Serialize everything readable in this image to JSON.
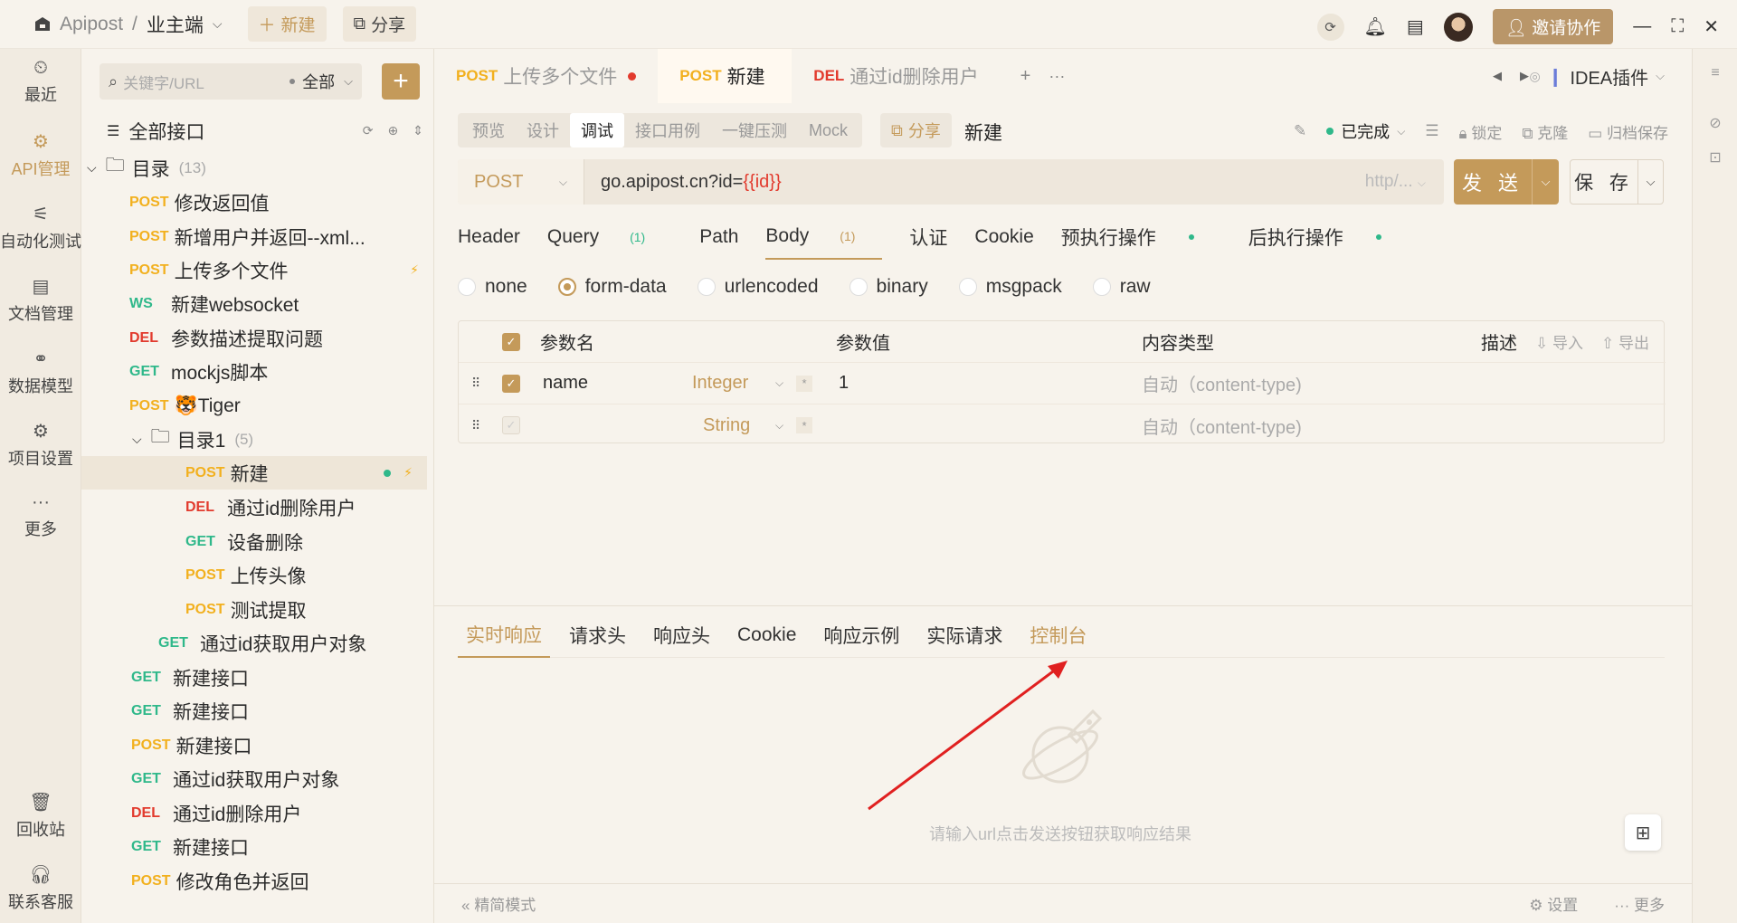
{
  "titlebar": {
    "app_name": "Apipost",
    "separator": "/",
    "project": "业主端",
    "new_label": "新建",
    "share_label": "分享",
    "invite_label": "邀请协作"
  },
  "rail": {
    "items": [
      {
        "label": "最近",
        "icon": "clock-icon"
      },
      {
        "label": "API管理",
        "icon": "api-icon"
      },
      {
        "label": "自动化测试",
        "icon": "automation-icon"
      },
      {
        "label": "文档管理",
        "icon": "document-icon"
      },
      {
        "label": "数据模型",
        "icon": "model-icon"
      },
      {
        "label": "项目设置",
        "icon": "settings-icon"
      },
      {
        "label": "更多",
        "icon": "more-icon"
      }
    ],
    "bottom": [
      {
        "label": "回收站",
        "icon": "trash-icon"
      },
      {
        "label": "联系客服",
        "icon": "headset-icon"
      }
    ]
  },
  "tree": {
    "search_placeholder": "关键字/URL",
    "scope": "全部",
    "header": "全部接口",
    "root_folder": {
      "name": "目录",
      "count": "(13)"
    },
    "sub_folder": {
      "name": "目录1",
      "count": "(5)"
    },
    "items_root": [
      {
        "method": "POST",
        "name": "修改返回值"
      },
      {
        "method": "POST",
        "name": "新增用户并返回--xml..."
      },
      {
        "method": "POST",
        "name": "上传多个文件"
      },
      {
        "method": "WS",
        "name": "新建websocket"
      },
      {
        "method": "DEL",
        "name": "参数描述提取问题"
      },
      {
        "method": "GET",
        "name": "mockjs脚本"
      },
      {
        "method": "POST",
        "name": "🐯Tiger"
      }
    ],
    "items_sub": [
      {
        "method": "POST",
        "name": "新建"
      },
      {
        "method": "DEL",
        "name": "通过id删除用户"
      },
      {
        "method": "GET",
        "name": "设备删除"
      },
      {
        "method": "POST",
        "name": "上传头像"
      },
      {
        "method": "POST",
        "name": "测试提取"
      }
    ],
    "item_after_sub": {
      "method": "GET",
      "name": "通过id获取用户对象"
    },
    "items_top": [
      {
        "method": "GET",
        "name": "新建接口"
      },
      {
        "method": "GET",
        "name": "新建接口"
      },
      {
        "method": "POST",
        "name": "新建接口"
      },
      {
        "method": "GET",
        "name": "通过id获取用户对象"
      },
      {
        "method": "DEL",
        "name": "通过id删除用户"
      },
      {
        "method": "GET",
        "name": "新建接口"
      },
      {
        "method": "POST",
        "name": "修改角色并返回"
      }
    ]
  },
  "tabs": [
    {
      "method": "POST",
      "name": "上传多个文件"
    },
    {
      "method": "POST",
      "name": "新建"
    },
    {
      "method": "DEL",
      "name": "通过id删除用户"
    }
  ],
  "plugin_label": "IDEA插件",
  "subnav": [
    "预览",
    "设计",
    "调试",
    "接口用例",
    "一键压测",
    "Mock"
  ],
  "share_chip": "分享",
  "request_name": "新建",
  "request_actions": {
    "status": "已完成",
    "lock": "锁定",
    "clone": "克隆",
    "archive": "归档保存"
  },
  "urlbar": {
    "method": "POST",
    "url_prefix": "go.apipost.cn?id=",
    "url_var": "{{id}}",
    "env": "http/..."
  },
  "send_label": "发 送",
  "save_label": "保 存",
  "param_tabs": {
    "header": "Header",
    "query": "Query",
    "query_count": "(1)",
    "path": "Path",
    "body": "Body",
    "body_count": "(1)",
    "auth": "认证",
    "cookie": "Cookie",
    "pre": "预执行操作",
    "post": "后执行操作"
  },
  "body_types": [
    "none",
    "form-data",
    "urlencoded",
    "binary",
    "msgpack",
    "raw"
  ],
  "param_table": {
    "headers": {
      "name": "参数名",
      "value": "参数值",
      "content_type": "内容类型",
      "desc": "描述",
      "import": "导入",
      "export": "导出"
    },
    "rows": [
      {
        "name": "name",
        "type": "Integer",
        "value": "1",
        "content_type": "自动（content-type)"
      },
      {
        "name": "",
        "type": "String",
        "value": "",
        "content_type": "自动（content-type)"
      }
    ]
  },
  "response_tabs": [
    "实时响应",
    "请求头",
    "响应头",
    "Cookie",
    "响应示例",
    "实际请求",
    "控制台"
  ],
  "empty_hint": "请输入url点击发送按钮获取响应结果",
  "footer": {
    "mode": "精简模式",
    "settings": "设置",
    "more": "更多"
  },
  "colors": {
    "accent": "#c49a5a",
    "post": "#f2b01e",
    "get": "#2fb88a",
    "del": "#e23a2d",
    "annotation_arrow": "#e02020"
  }
}
